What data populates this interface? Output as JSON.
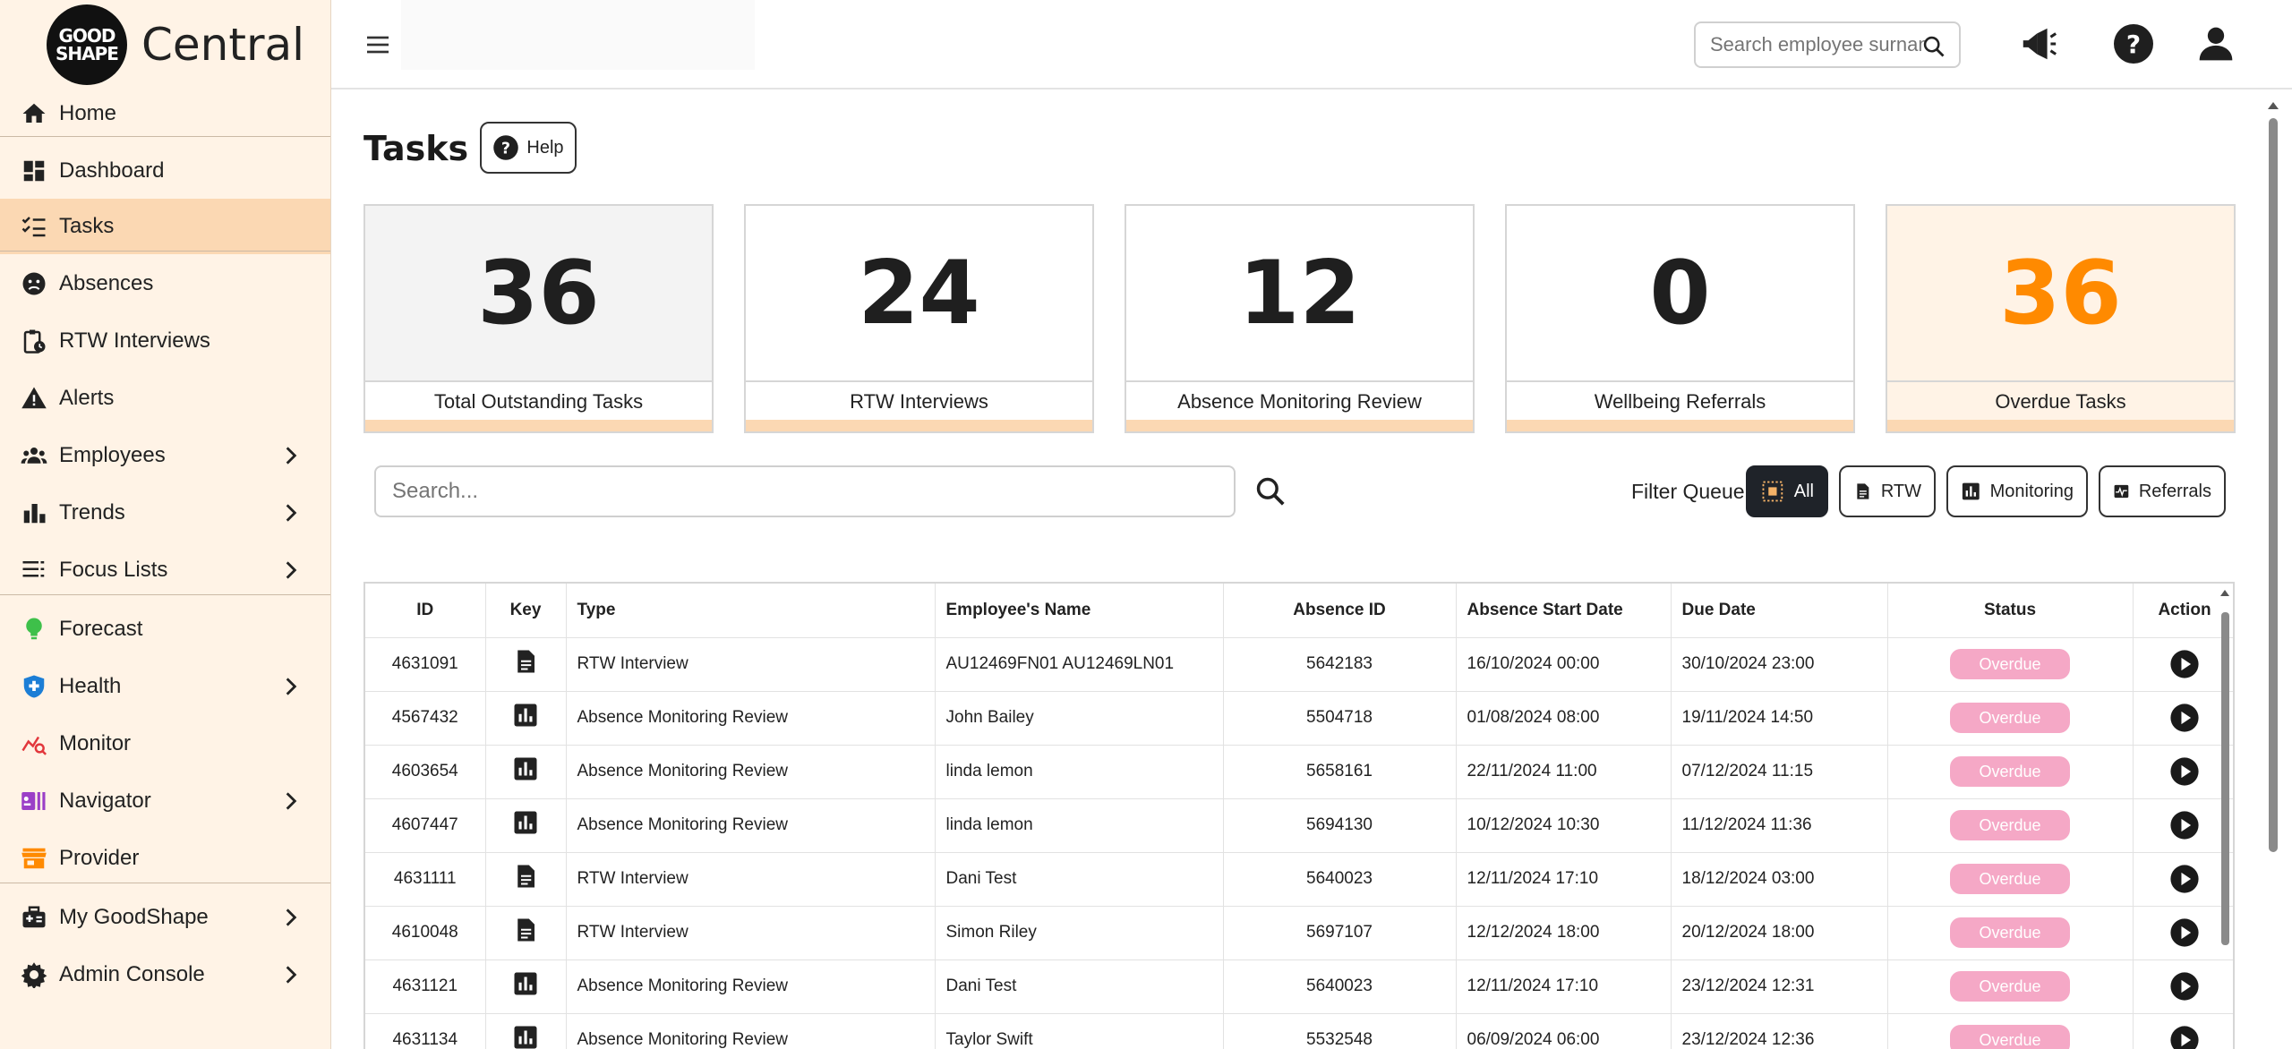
{
  "brand": {
    "logo_line1": "GOOD",
    "logo_line2": "SHAPE",
    "name": "Central"
  },
  "sidebar": {
    "items": [
      {
        "label": "Home",
        "icon": "home-icon",
        "has_chevron": false
      },
      {
        "label": "Dashboard",
        "icon": "dashboard-icon",
        "has_chevron": false
      },
      {
        "label": "Tasks",
        "icon": "tasks-icon",
        "has_chevron": false,
        "active": true
      },
      {
        "label": "Absences",
        "icon": "sad-face-icon",
        "has_chevron": false
      },
      {
        "label": "RTW Interviews",
        "icon": "clipboard-clock-icon",
        "has_chevron": false
      },
      {
        "label": "Alerts",
        "icon": "warning-icon",
        "has_chevron": false
      },
      {
        "label": "Employees",
        "icon": "people-icon",
        "has_chevron": true
      },
      {
        "label": "Trends",
        "icon": "bar-chart-icon",
        "has_chevron": true
      },
      {
        "label": "Focus Lists",
        "icon": "list-icon",
        "has_chevron": true
      },
      {
        "label": "Forecast",
        "icon": "lightbulb-icon",
        "has_chevron": false
      },
      {
        "label": "Health",
        "icon": "shield-plus-icon",
        "has_chevron": true
      },
      {
        "label": "Monitor",
        "icon": "monitor-graph-icon",
        "has_chevron": false
      },
      {
        "label": "Navigator",
        "icon": "navigator-icon",
        "has_chevron": true
      },
      {
        "label": "Provider",
        "icon": "store-icon",
        "has_chevron": false
      },
      {
        "label": "My GoodShape",
        "icon": "medical-bag-icon",
        "has_chevron": true
      },
      {
        "label": "Admin Console",
        "icon": "gear-icon",
        "has_chevron": true
      }
    ]
  },
  "topbar": {
    "search_placeholder": "Search employee surname..."
  },
  "page": {
    "title": "Tasks",
    "help_label": "Help"
  },
  "cards": [
    {
      "value": "36",
      "label": "Total Outstanding Tasks"
    },
    {
      "value": "24",
      "label": "RTW Interviews"
    },
    {
      "value": "12",
      "label": "Absence Monitoring Review"
    },
    {
      "value": "0",
      "label": "Wellbeing Referrals"
    },
    {
      "value": "36",
      "label": "Overdue Tasks"
    }
  ],
  "filters": {
    "search_placeholder": "Search...",
    "queue_label": "Filter Queue:",
    "buttons": [
      "All",
      "RTW",
      "Monitoring",
      "Referrals"
    ],
    "active": "All"
  },
  "table": {
    "headers": [
      "ID",
      "Key",
      "Type",
      "Employee's Name",
      "Absence ID",
      "Absence Start Date",
      "Due Date",
      "Status",
      "Action"
    ],
    "rows": [
      {
        "id": "4631091",
        "key": "document",
        "type": "RTW Interview",
        "name": "AU12469FN01 AU12469LN01",
        "absence_id": "5642183",
        "start": "16/10/2024 00:00",
        "due": "30/10/2024 23:00",
        "status": "Overdue"
      },
      {
        "id": "4567432",
        "key": "chart",
        "type": "Absence Monitoring Review",
        "name": "John Bailey",
        "absence_id": "5504718",
        "start": "01/08/2024 08:00",
        "due": "19/11/2024 14:50",
        "status": "Overdue"
      },
      {
        "id": "4603654",
        "key": "chart",
        "type": "Absence Monitoring Review",
        "name": "linda lemon",
        "absence_id": "5658161",
        "start": "22/11/2024 11:00",
        "due": "07/12/2024 11:15",
        "status": "Overdue"
      },
      {
        "id": "4607447",
        "key": "chart",
        "type": "Absence Monitoring Review",
        "name": "linda lemon",
        "absence_id": "5694130",
        "start": "10/12/2024 10:30",
        "due": "11/12/2024 11:36",
        "status": "Overdue"
      },
      {
        "id": "4631111",
        "key": "document",
        "type": "RTW Interview",
        "name": "Dani Test",
        "absence_id": "5640023",
        "start": "12/11/2024 17:10",
        "due": "18/12/2024 03:00",
        "status": "Overdue"
      },
      {
        "id": "4610048",
        "key": "document",
        "type": "RTW Interview",
        "name": "Simon Riley",
        "absence_id": "5697107",
        "start": "12/12/2024 18:00",
        "due": "20/12/2024 18:00",
        "status": "Overdue"
      },
      {
        "id": "4631121",
        "key": "chart",
        "type": "Absence Monitoring Review",
        "name": "Dani Test",
        "absence_id": "5640023",
        "start": "12/11/2024 17:10",
        "due": "23/12/2024 12:31",
        "status": "Overdue"
      },
      {
        "id": "4631134",
        "key": "chart",
        "type": "Absence Monitoring Review",
        "name": "Taylor Swift",
        "absence_id": "5532548",
        "start": "06/09/2024 06:00",
        "due": "23/12/2024 12:36",
        "status": "Overdue"
      }
    ]
  },
  "colors": {
    "accent": "#ff8a00",
    "sidebar_bg": "#fff3e6",
    "active_nav": "#fbd8b3",
    "status_overdue": "#f5a8c6"
  }
}
